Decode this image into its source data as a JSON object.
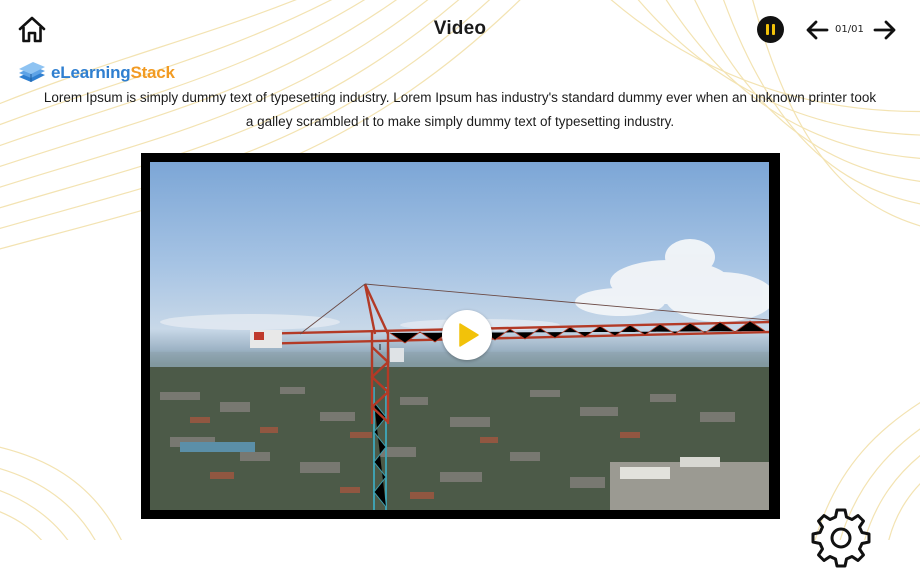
{
  "header": {
    "title": "Video",
    "page_counter": "01/01",
    "icons": {
      "home": "home-icon",
      "pause": "pause-icon",
      "prev": "arrow-left-icon",
      "next": "arrow-right-icon"
    }
  },
  "logo": {
    "part1": "e",
    "part2": "Learning",
    "part3": "Stack"
  },
  "content": {
    "description": "Lorem Ipsum is simply dummy text of typesetting industry. Lorem Ipsum has industry's standard dummy ever when an unknown printer took a galley scrambled it to make simply dummy text of typesetting industry."
  },
  "video": {
    "play_icon": "play-icon",
    "thumbnail": "construction-crane-city-aerial"
  },
  "footer": {
    "settings_icon": "gear-icon"
  },
  "colors": {
    "accent": "#f2c20a",
    "logo_blue": "#2f7fd0",
    "logo_orange": "#f29b23",
    "pattern": "#f3e3b2"
  }
}
